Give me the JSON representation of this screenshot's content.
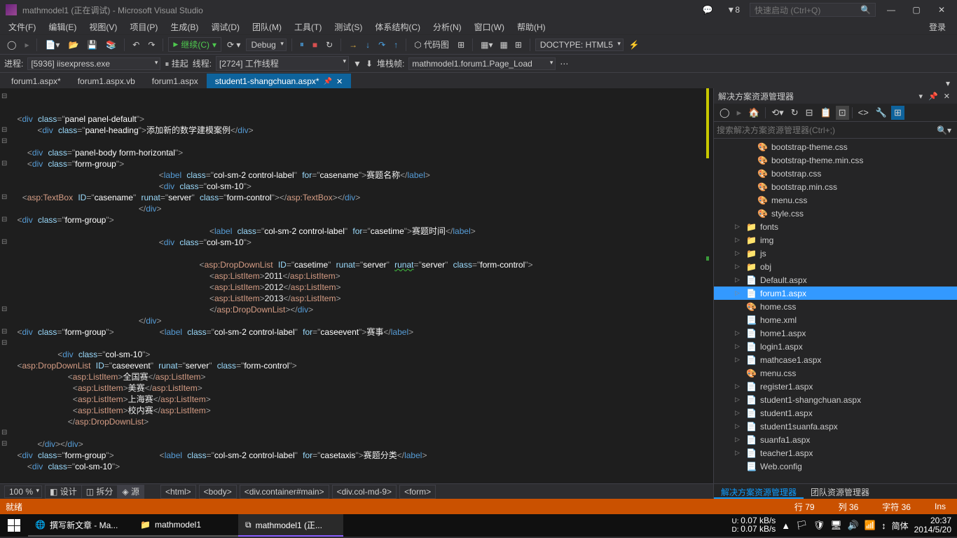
{
  "title": "mathmodel1 (正在调试) - Microsoft Visual Studio",
  "notif_count": "8",
  "quick_launch": "快速启动 (Ctrl+Q)",
  "login": "登录",
  "menu": [
    "文件(F)",
    "编辑(E)",
    "视图(V)",
    "项目(P)",
    "生成(B)",
    "调试(D)",
    "团队(M)",
    "工具(T)",
    "测试(S)",
    "体系结构(C)",
    "分析(N)",
    "窗口(W)",
    "帮助(H)"
  ],
  "toolbar": {
    "continue": "继续(C)",
    "config": "Debug",
    "codemap": "代码图",
    "doctype": "DOCTYPE: HTML5"
  },
  "debugbar": {
    "process_lbl": "进程:",
    "process_val": "[5936] iisexpress.exe",
    "suspend": "挂起",
    "thread_lbl": "线程:",
    "thread_val": "[2724] 工作线程",
    "stack_lbl": "堆栈帧:",
    "stack_val": "mathmodel1.forum1.Page_Load"
  },
  "tabs": [
    {
      "label": "forum1.aspx*",
      "active": false
    },
    {
      "label": "forum1.aspx.vb",
      "active": false
    },
    {
      "label": "forum1.aspx",
      "active": false
    },
    {
      "label": "student1-shangchuan.aspx*",
      "active": true
    }
  ],
  "editor_footer": {
    "zoom": "100 %",
    "views": [
      "设计",
      "拆分",
      "源"
    ],
    "active_view": 2,
    "breadcrumb": [
      "<html>",
      "<body>",
      "<div.container#main>",
      "<div.col-md-9>",
      "<form>"
    ]
  },
  "solution": {
    "title": "解决方案资源管理器",
    "search": "搜索解决方案资源管理器(Ctrl+;)",
    "items": [
      {
        "type": "css",
        "name": "bootstrap-theme.css",
        "depth": 2
      },
      {
        "type": "css",
        "name": "bootstrap-theme.min.css",
        "depth": 2
      },
      {
        "type": "css",
        "name": "bootstrap.css",
        "depth": 2
      },
      {
        "type": "css",
        "name": "bootstrap.min.css",
        "depth": 2
      },
      {
        "type": "css",
        "name": "menu.css",
        "depth": 2
      },
      {
        "type": "css",
        "name": "style.css",
        "depth": 2
      },
      {
        "type": "folder",
        "name": "fonts",
        "depth": 1,
        "exp": "▷"
      },
      {
        "type": "folder",
        "name": "img",
        "depth": 1,
        "exp": "▷"
      },
      {
        "type": "folder",
        "name": "js",
        "depth": 1,
        "exp": "▷"
      },
      {
        "type": "folder",
        "name": "obj",
        "depth": 1,
        "exp": "▷"
      },
      {
        "type": "aspx",
        "name": "Default.aspx",
        "depth": 1,
        "exp": "▷"
      },
      {
        "type": "aspx",
        "name": "forum1.aspx",
        "depth": 1,
        "exp": "▷",
        "sel": true
      },
      {
        "type": "css",
        "name": "home.css",
        "depth": 1
      },
      {
        "type": "xml",
        "name": "home.xml",
        "depth": 1
      },
      {
        "type": "aspx",
        "name": "home1.aspx",
        "depth": 1,
        "exp": "▷"
      },
      {
        "type": "aspx",
        "name": "login1.aspx",
        "depth": 1,
        "exp": "▷"
      },
      {
        "type": "aspx",
        "name": "mathcase1.aspx",
        "depth": 1,
        "exp": "▷"
      },
      {
        "type": "css",
        "name": "menu.css",
        "depth": 1
      },
      {
        "type": "aspx",
        "name": "register1.aspx",
        "depth": 1,
        "exp": "▷"
      },
      {
        "type": "aspx",
        "name": "student1-shangchuan.aspx",
        "depth": 1,
        "exp": "▷"
      },
      {
        "type": "aspx",
        "name": "student1.aspx",
        "depth": 1,
        "exp": "▷"
      },
      {
        "type": "aspx",
        "name": "student1suanfa.aspx",
        "depth": 1,
        "exp": "▷"
      },
      {
        "type": "aspx",
        "name": "suanfa1.aspx",
        "depth": 1,
        "exp": "▷"
      },
      {
        "type": "aspx",
        "name": "teacher1.aspx",
        "depth": 1,
        "exp": "▷"
      },
      {
        "type": "xml",
        "name": "Web.config",
        "depth": 1
      }
    ],
    "tabs": [
      "解决方案资源管理器",
      "团队资源管理器"
    ],
    "active_tab": 0
  },
  "statusbar": {
    "ready": "就绪",
    "line": "行 79",
    "col": "列 36",
    "char": "字符 36",
    "mode": "Ins"
  },
  "taskbar": {
    "items": [
      {
        "icon": "🌐",
        "label": "撰写新文章 - Ma..."
      },
      {
        "icon": "📁",
        "label": "mathmodel1"
      },
      {
        "icon": "⧉",
        "label": "mathmodel1 (正...",
        "active": true
      }
    ],
    "net_up": "0.07 kB/s",
    "net_dn": "0.07 kB/s",
    "ime": "简体",
    "time": "20:37",
    "date": "2014/5/20"
  }
}
